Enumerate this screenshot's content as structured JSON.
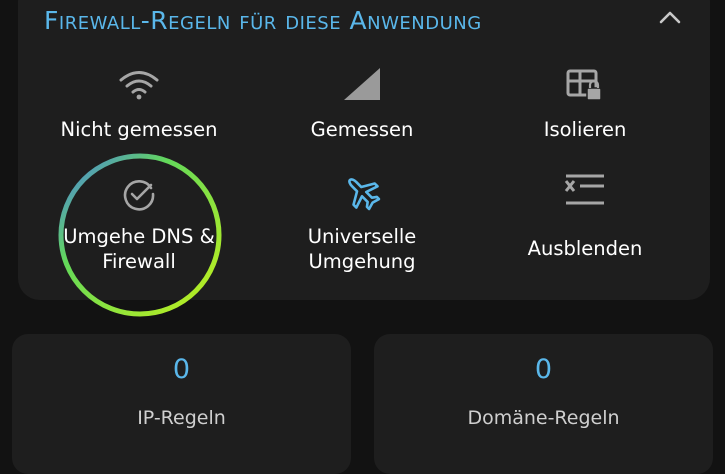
{
  "section": {
    "title": "Firewall-Regeln für diese Anwendung",
    "collapse_icon": "chevron-up-icon"
  },
  "options": [
    {
      "label": "Nicht gemessen",
      "icon": "wifi-icon"
    },
    {
      "label": "Gemessen",
      "icon": "signal-triangle-icon"
    },
    {
      "label": "Isolieren",
      "icon": "table-lock-icon"
    },
    {
      "label_line1": "Umgehe DNS &",
      "label_line2": "Firewall",
      "icon": "check-circle-icon",
      "selected": true
    },
    {
      "label_line1": "Universelle",
      "label_line2": "Umgehung",
      "icon": "airplane-icon"
    },
    {
      "label": "Ausblenden",
      "icon": "hide-list-icon"
    }
  ],
  "stats": [
    {
      "value": "0",
      "label": "IP-Regeln"
    },
    {
      "value": "0",
      "label": "Domäne-Regeln"
    }
  ],
  "colors": {
    "accent": "#5ab7ea",
    "card": "#1e1e1e",
    "background": "#121212",
    "ring_from": "#4a7ee8",
    "ring_to": "#b8f014"
  }
}
